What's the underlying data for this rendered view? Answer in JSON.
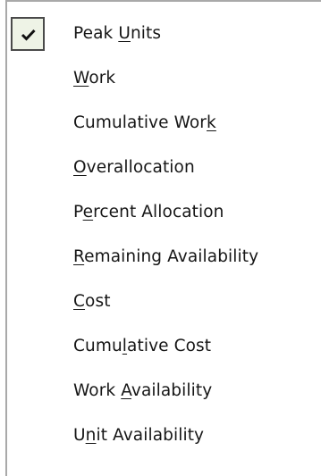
{
  "menu": {
    "items": [
      {
        "pre": "Peak ",
        "acc": "U",
        "post": "nits",
        "checked": true
      },
      {
        "pre": "",
        "acc": "W",
        "post": "ork",
        "checked": false
      },
      {
        "pre": "Cumulative Wor",
        "acc": "k",
        "post": "",
        "checked": false
      },
      {
        "pre": "",
        "acc": "O",
        "post": "verallocation",
        "checked": false
      },
      {
        "pre": "P",
        "acc": "e",
        "post": "rcent Allocation",
        "checked": false
      },
      {
        "pre": "",
        "acc": "R",
        "post": "emaining Availability",
        "checked": false
      },
      {
        "pre": "",
        "acc": "C",
        "post": "ost",
        "checked": false
      },
      {
        "pre": "Cumu",
        "acc": "l",
        "post": "ative Cost",
        "checked": false
      },
      {
        "pre": "Work ",
        "acc": "A",
        "post": "vailability",
        "checked": false
      },
      {
        "pre": "U",
        "acc": "n",
        "post": "it Availability",
        "checked": false
      }
    ],
    "check_icon": "checkmark-icon",
    "colors": {
      "text": "#161616",
      "check_bg": "#eef3e6",
      "border": "#a9a9a9"
    }
  }
}
